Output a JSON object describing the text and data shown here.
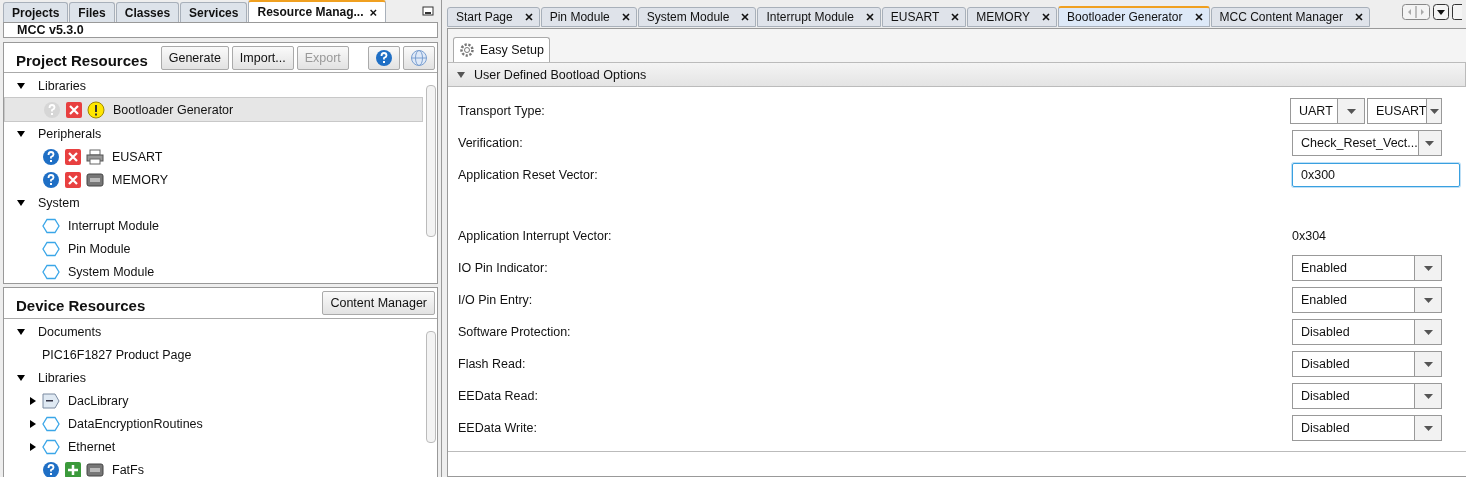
{
  "left_tabs": [
    {
      "label": "Projects",
      "selected": false
    },
    {
      "label": "Files",
      "selected": false
    },
    {
      "label": "Classes",
      "selected": false
    },
    {
      "label": "Services",
      "selected": false
    },
    {
      "label": "Resource Manag...",
      "selected": true,
      "close": "×"
    }
  ],
  "mcc_version": "MCC v5.3.0",
  "project_resources": {
    "title": "Project Resources",
    "buttons": [
      {
        "label": "Generate",
        "disabled": false
      },
      {
        "label": "Import...",
        "disabled": false
      },
      {
        "label": "Export",
        "disabled": true
      }
    ],
    "tree": [
      {
        "label": "Libraries",
        "expanded": true,
        "children": [
          {
            "label": "Bootloader Generator",
            "selected": true,
            "kind": "warning"
          }
        ]
      },
      {
        "label": "Peripherals",
        "expanded": true,
        "children": [
          {
            "label": "EUSART",
            "selected": false,
            "kind": "serial"
          },
          {
            "label": "MEMORY",
            "selected": false,
            "kind": "memory"
          }
        ]
      },
      {
        "label": "System",
        "expanded": true,
        "children": [
          {
            "label": "Interrupt Module",
            "selected": false,
            "kind": "module"
          },
          {
            "label": "Pin Module",
            "selected": false,
            "kind": "module"
          },
          {
            "label": "System Module",
            "selected": false,
            "kind": "module"
          }
        ]
      }
    ]
  },
  "device_resources": {
    "title": "Device Resources",
    "button": "Content Manager",
    "tree": [
      {
        "label": "Documents",
        "expanded": true,
        "children": [
          {
            "label": "PIC16F1827 Product Page",
            "selected": false,
            "kind": "document"
          }
        ]
      },
      {
        "label": "Libraries",
        "expanded": true,
        "children": [
          {
            "label": "DacLibrary",
            "selected": false,
            "expanded": false,
            "kind": "daclib"
          },
          {
            "label": "DataEncryptionRoutines",
            "selected": false,
            "expanded": false,
            "kind": "module"
          },
          {
            "label": "Ethernet",
            "selected": false,
            "expanded": false,
            "kind": "module"
          },
          {
            "label": "FatFs",
            "selected": false,
            "kind": "addable"
          }
        ]
      }
    ]
  },
  "editor_tabs": [
    {
      "label": "Start Page",
      "selected": false
    },
    {
      "label": "Pin Module",
      "selected": false
    },
    {
      "label": "System Module",
      "selected": false
    },
    {
      "label": "Interrupt Module",
      "selected": false
    },
    {
      "label": "EUSART",
      "selected": false
    },
    {
      "label": "MEMORY",
      "selected": false
    },
    {
      "label": "Bootloader Generator",
      "selected": true
    },
    {
      "label": "MCC Content Manager",
      "selected": false
    }
  ],
  "sub_tab": "Easy Setup",
  "section": {
    "title": "User Defined Bootload Options",
    "expanded": true
  },
  "settings": [
    {
      "label": "Transport Type:",
      "kind": "combo2",
      "values": [
        "UART",
        "EUSART"
      ]
    },
    {
      "label": "Verification:",
      "kind": "combo",
      "value": "Check_Reset_Vect..."
    },
    {
      "label": "Application Reset Vector:",
      "kind": "text",
      "value": "0x300"
    },
    {
      "label": "Application Interrupt Vector:",
      "kind": "readonly",
      "value": "0x304"
    },
    {
      "label": "IO Pin Indicator:",
      "kind": "combo",
      "value": "Enabled"
    },
    {
      "label": "I/O Pin Entry:",
      "kind": "combo",
      "value": "Enabled"
    },
    {
      "label": "Software Protection:",
      "kind": "combo",
      "value": "Disabled"
    },
    {
      "label": "Flash Read:",
      "kind": "combo",
      "value": "Disabled"
    },
    {
      "label": "EEData Read:",
      "kind": "combo",
      "value": "Disabled"
    },
    {
      "label": "EEData Write:",
      "kind": "combo",
      "value": "Disabled"
    }
  ]
}
